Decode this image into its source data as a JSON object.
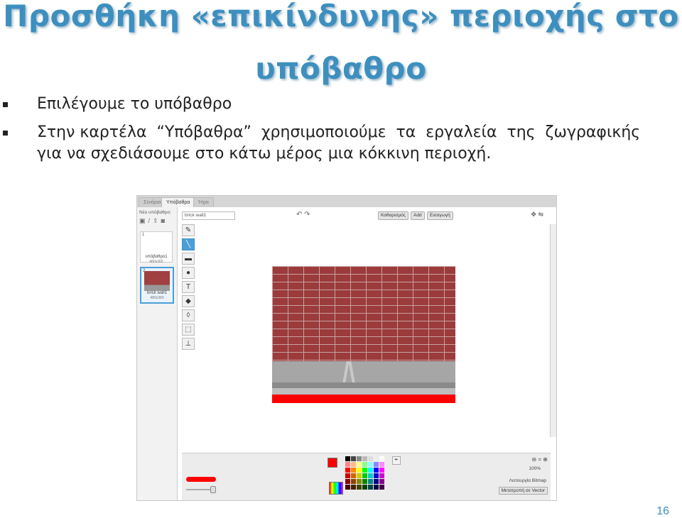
{
  "slide": {
    "title_line1": "Προσθήκη «επικίνδυνης» περιοχής στο",
    "title_line2": "υπόβαθρο",
    "bullet1": "Επιλέγουμε το υπόβαθρο",
    "bullet2_line1": "Στην καρτέλα  “Υπόβαθρα”  χρησιμοποιούμε  τα  εργαλεία  της  ζωγραφικής",
    "bullet2_line2": "για να σχεδιάσουμε στο κάτω μέρος μια κόκκινη περιοχή.",
    "page_number": "16"
  },
  "scratch": {
    "tabs": [
      "Σενάρια",
      "Υπόβαθρα",
      "Ήχοι"
    ],
    "active_tab": "Υπόβαθρα",
    "new_backdrop_label": "Νέο υπόβαθρο:",
    "backdrops": [
      {
        "num": "1",
        "name": "υπόβαθρο1",
        "dims": "480x360"
      },
      {
        "num": "2",
        "name": "brick wall1",
        "dims": "480x360"
      }
    ],
    "costume_name": "brick wall1",
    "buttons": {
      "clear": "Καθαρισμός",
      "add": "Add",
      "import": "Εισαγωγή"
    },
    "zoom_level": "100%",
    "mode_label": "Λειτουργία Bitmap",
    "convert_label": "Μετατροπή σε Vector",
    "selected_color": "#ff0000"
  }
}
